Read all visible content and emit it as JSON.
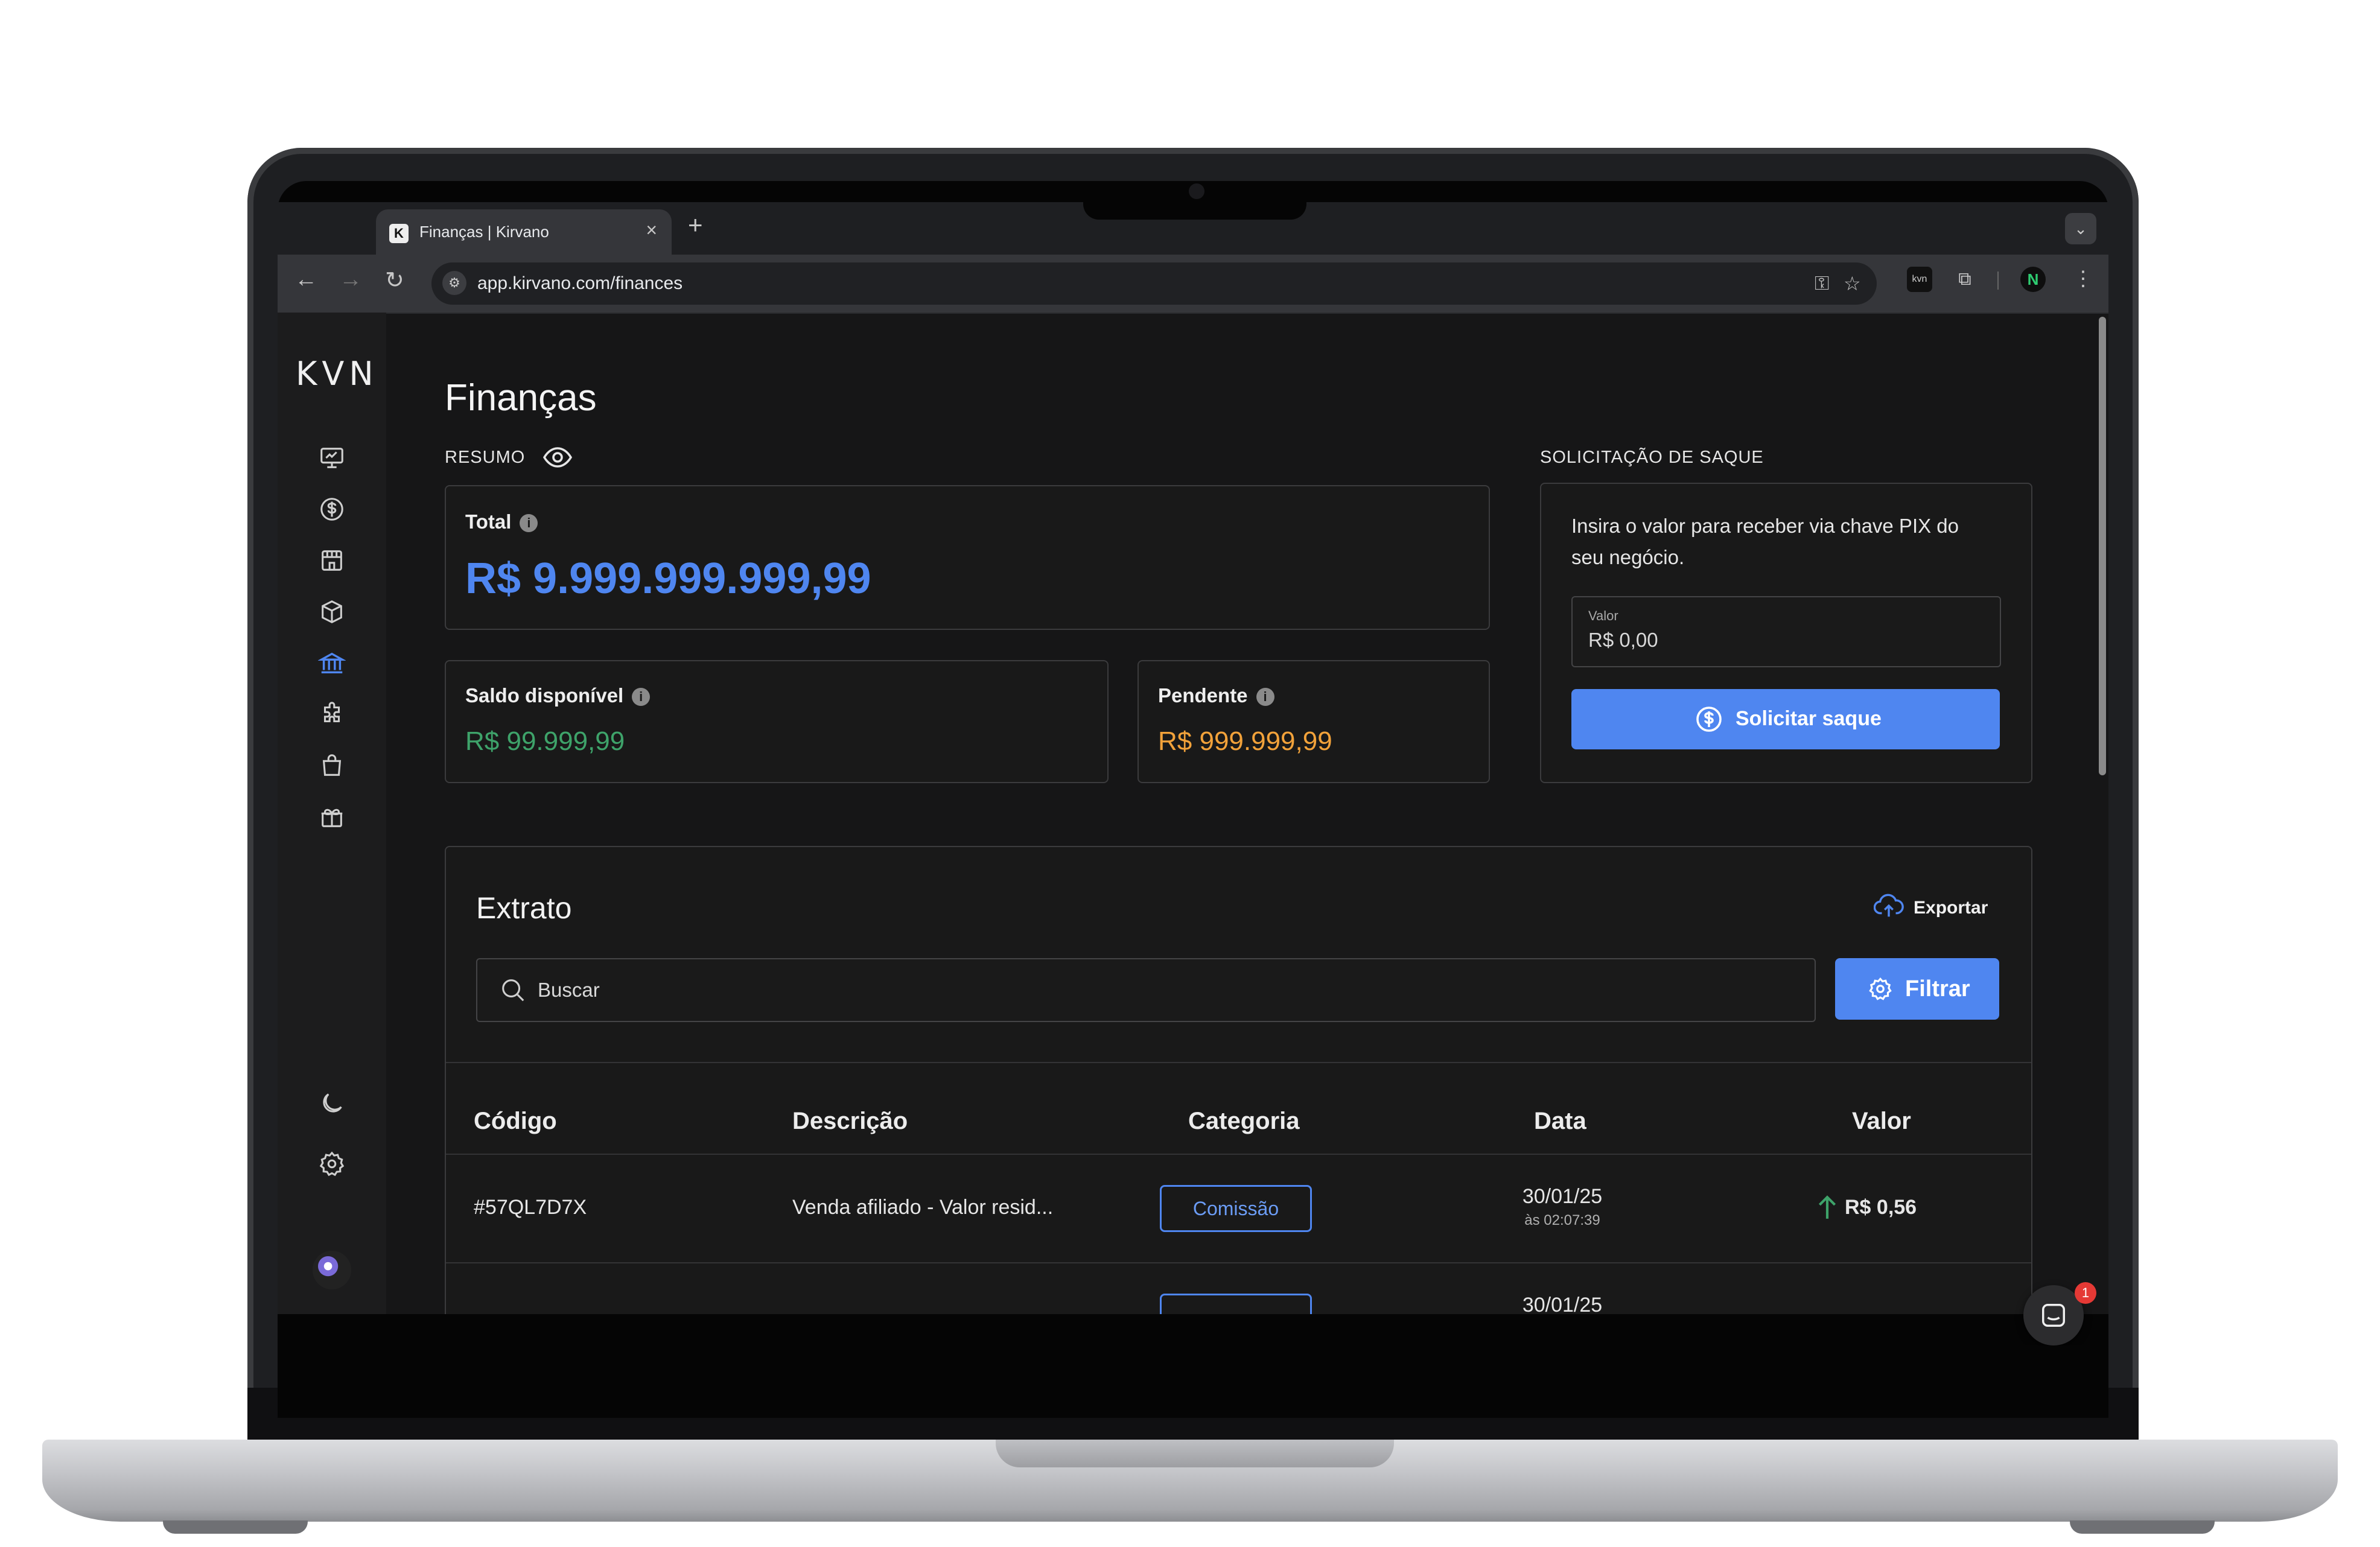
{
  "browser": {
    "tab_title": "Finanças | Kirvano",
    "tab_favicon": "K",
    "url": "app.kirvano.com/finances",
    "profile_initial": "N"
  },
  "app": {
    "logo": "KVN",
    "page_title": "Finanças",
    "sidebar_icons": [
      "dashboard-icon",
      "dollar-icon",
      "store-icon",
      "box-icon",
      "bank-icon",
      "puzzle-icon",
      "bag-icon",
      "gift-icon",
      "moon-icon",
      "gear-icon"
    ],
    "active_sidebar": "bank-icon"
  },
  "resumo": {
    "label": "RESUMO",
    "total_label": "Total",
    "total_value": "R$ 9.999.999.999,99",
    "saldo_label": "Saldo disponível",
    "saldo_value": "R$ 99.999,99",
    "pendente_label": "Pendente",
    "pendente_value": "R$ 999.999,99"
  },
  "saque": {
    "label": "SOLICITAÇÃO DE SAQUE",
    "description_line1": "Insira o valor para receber via chave PIX do",
    "description_line2": "seu negócio.",
    "valor_label": "Valor",
    "valor_value": "R$ 0,00",
    "button": "Solicitar saque"
  },
  "extrato": {
    "title": "Extrato",
    "export": "Exportar",
    "search_placeholder": "Buscar",
    "filter": "Filtrar",
    "columns": [
      "Código",
      "Descrição",
      "Categoria",
      "Data",
      "Valor"
    ],
    "rows": [
      {
        "codigo": "#57QL7D7X",
        "descricao": "Venda afiliado - Valor resid...",
        "categoria": "Comissão",
        "data": "30/01/25",
        "hora": "às 02:07:39",
        "valor": "R$ 0,56"
      },
      {
        "data": "30/01/25"
      }
    ]
  },
  "chat": {
    "badge": "1"
  },
  "colors": {
    "accent": "#4f86f0",
    "positive": "#3ea36a",
    "pending": "#f2a23a",
    "background": "#161617"
  }
}
